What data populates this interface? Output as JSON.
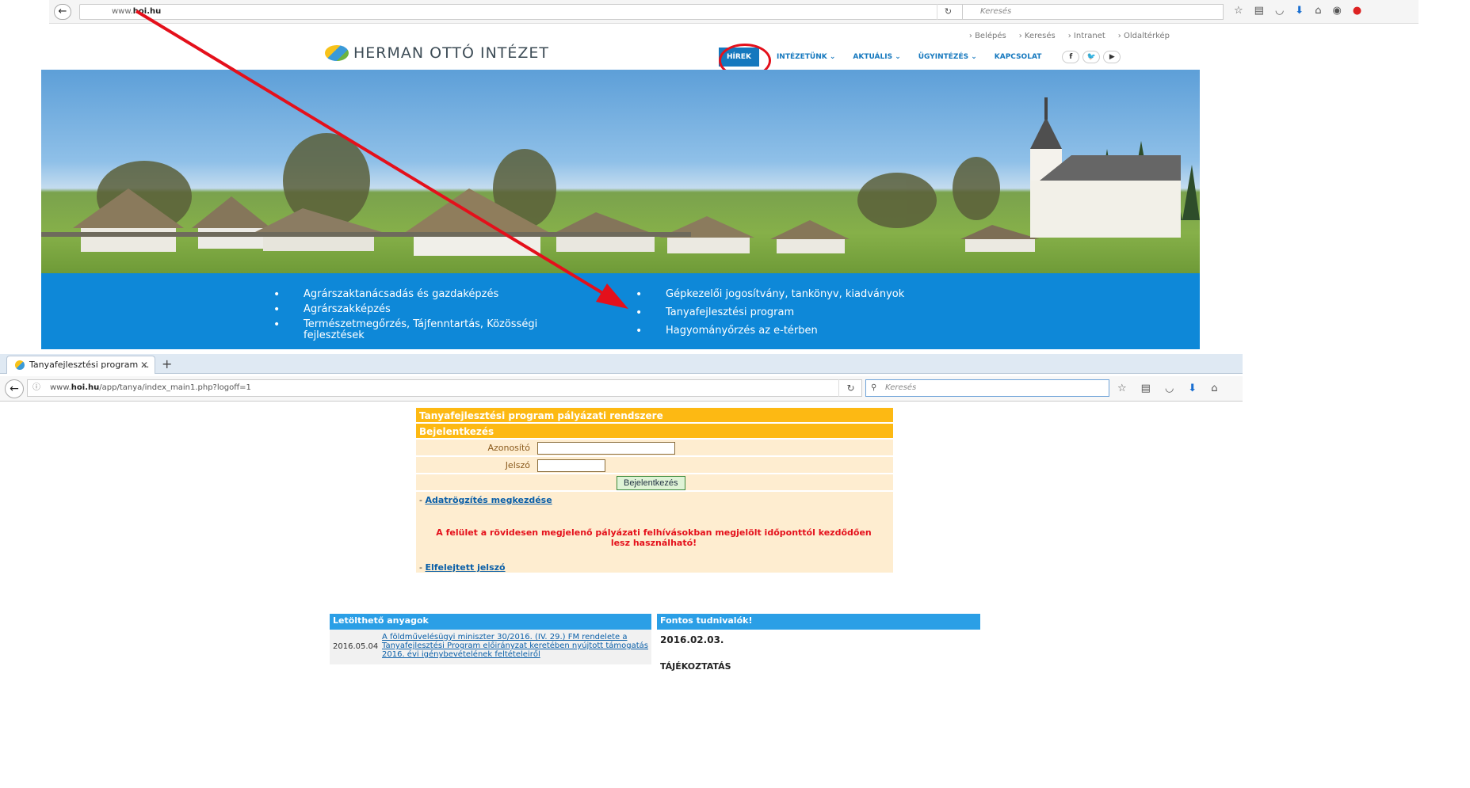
{
  "top_browser": {
    "url_host": "www.hoi.hu",
    "url_prefix": "www.",
    "url_bold": "hoi.hu",
    "search_placeholder": "Keresés",
    "toolbar_icons": [
      "star-icon",
      "reader-icon",
      "pocket-icon",
      "download-icon",
      "home-icon",
      "chat-icon",
      "adblock-icon"
    ]
  },
  "site": {
    "logo_text": "HERMAN OTTÓ INTÉZET",
    "utility_links": [
      "› Belépés",
      "› Keresés",
      "› Intranet",
      "› Oldaltérkép"
    ],
    "nav": [
      "HÍREK",
      "INTÉZETÜNK ⌄",
      "AKTUÁLIS ⌄",
      "ÜGYINTÉZÉS ⌄",
      "KAPCSOLAT"
    ],
    "social": [
      "f",
      "🐦",
      "▶"
    ],
    "services_left": [
      "Agrárszaktanácsadás és gazdaképzés",
      "Agrárszakképzés",
      "Természetmegőrzés, Tájfenntartás, Közösségi fejlesztések"
    ],
    "services_right": [
      "Gépkezelői jogosítvány, tankönyv, kiadványok",
      "Tanyafejlesztési program",
      "Hagyományőrzés az e-térben"
    ]
  },
  "bottom_browser": {
    "tab_title": "Tanyafejlesztési program ...",
    "tab_close": "✕",
    "new_tab": "+",
    "url_prefix": "www.",
    "url_bold": "hoi.hu",
    "url_path": "/app/tanya/index_main1.php?logoff=1",
    "search_placeholder": "Keresés"
  },
  "login": {
    "system_title": "Tanyafejlesztési program pályázati rendszere",
    "section_title": "Bejelentkezés",
    "id_label": "Azonosító",
    "password_label": "Jelszó",
    "submit": "Bejelentkezés",
    "start_link_prefix": "- ",
    "start_link": "Adatrögzítés megkezdése",
    "warning": "A felület a rövidesen megjelenő pályázati felhívásokban megjelölt időponttól kezdődően lesz használható!",
    "forgot_prefix": "- ",
    "forgot_link": "Elfelejtett jelszó"
  },
  "downloads": {
    "title": "Letölthető anyagok",
    "items": [
      {
        "date": "2016.05.04",
        "text": "A földművelésügyi miniszter 30/2016. (IV. 29.) FM rendelete a Tanyafejlesztési Program előirányzat keretében nyújtott támogatás 2016. évi igénybevételének feltételeiről"
      }
    ]
  },
  "notices": {
    "title": "Fontos tudnivalók!",
    "date": "2016.02.03.",
    "heading": "TÁJÉKOZTATÁS"
  },
  "colors": {
    "brand_blue": "#0e88d8",
    "header_yellow": "#fdb913",
    "form_bg": "#feedd0",
    "annotation_red": "#e4101b"
  }
}
